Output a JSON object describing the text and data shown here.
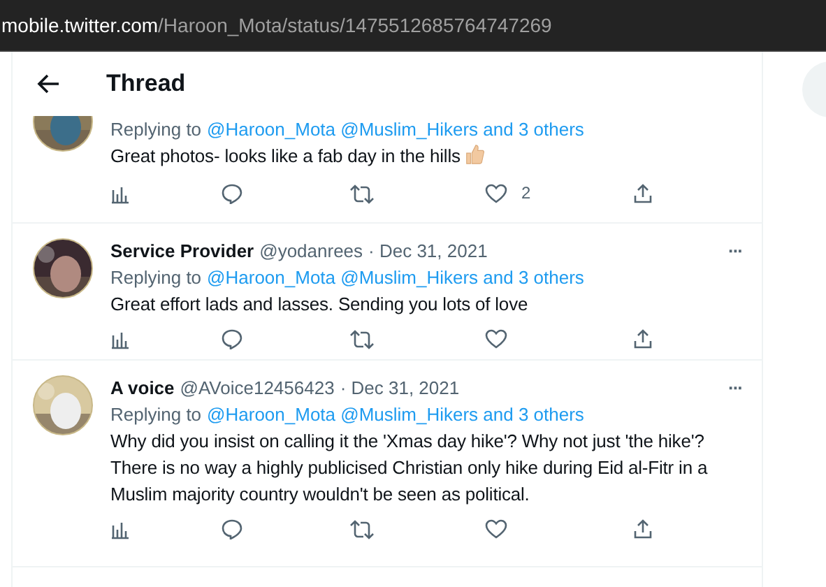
{
  "address_bar": {
    "host": "mobile.twitter.com",
    "path": "/Haroon_Mota/status/1475512685764747269"
  },
  "header": {
    "title": "Thread"
  },
  "tweets": [
    {
      "replying_label": "Replying to",
      "mentions": "@Haroon_Mota @Muslim_Hikers and 3 others",
      "text": "Great photos- looks like a fab day in the hills",
      "thumbs_up": true,
      "like_count": "2"
    },
    {
      "name": "Service Provider",
      "handle": "@yodanrees",
      "date": "· Dec 31, 2021",
      "more": "···",
      "replying_label": "Replying to",
      "mentions": "@Haroon_Mota @Muslim_Hikers and 3 others",
      "text": "Great effort lads and lasses. Sending you lots of love",
      "thumbs_up": false
    },
    {
      "name": "A voice",
      "handle": "@AVoice12456423",
      "date": "· Dec 31, 2021",
      "more": "···",
      "replying_label": "Replying to",
      "mentions": "@Haroon_Mota @Muslim_Hikers and 3 others",
      "text": "Why did you insist on calling it the 'Xmas day hike'? Why not just 'the hike'? There is no way a highly publicised Christian only hike during Eid al-Fitr in a Muslim majority country wouldn't be seen as political.",
      "thumbs_up": false
    }
  ]
}
